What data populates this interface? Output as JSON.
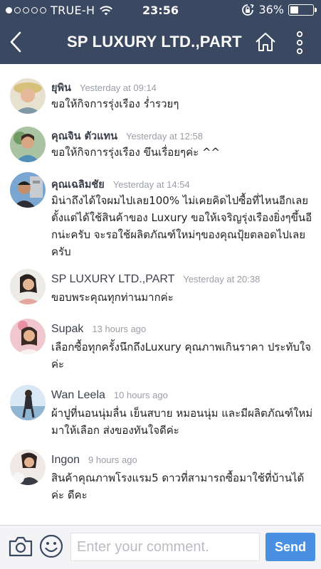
{
  "status_bar": {
    "carrier": "TRUE-H",
    "time": "23:56",
    "battery": "36%",
    "battery_level": 0.36,
    "signal_dots_filled": 1,
    "signal_dots_total": 5
  },
  "nav": {
    "title": "SP LUXURY LTD.,PART",
    "icons": [
      "chevron-left-icon",
      "home-icon",
      "more-vertical-icon"
    ]
  },
  "comments": [
    {
      "name": "ยุพิน",
      "time": "Yesterday at 09:14",
      "text": "ขอให้กิจการรุ่งเรือง ร่ำรวยๆ"
    },
    {
      "name": "คุณจิน ตัวแทน",
      "time": "Yesterday at 12:58",
      "text": "ขอให้กิจการรุ่งเรือง ขึนเรื่อยๆค่ะ ^^"
    },
    {
      "name": "คุณเฉลิมชัย",
      "time": "Yesterday at 14:54",
      "text": "มิน่าถึงได้ใจผมไปเลย100% ไม่เคยคิดไปซื้อที่ไหนอีกเลย ตั้งแต่ได้ใช้สินค้าของ Luxury ขอให้เจริญรุ่งเรืองยิ่งๆขึ้นอีกน่ะครับ จะรอใช้ผลิตภัณฑ์ใหม่ๆของคุณปุ้ยตลอดไปเลยครับ"
    },
    {
      "name": "SP LUXURY LTD.,PART",
      "time": "Yesterday at 20:38",
      "text": "ขอบพระคุณทุกท่านมากค่ะ"
    },
    {
      "name": "Supak",
      "time": "13 hours ago",
      "text": "เลือกซื้อทุกครั้งนึกถึงLuxury คุณภาพเกินราคา ประทับใจค่ะ"
    },
    {
      "name": "Wan Leela",
      "time": "10 hours ago",
      "text": "ผ้าปูที่นอนนุ่มลื่น เย็นสบาย หมอนนุ่ม และมีผลิตภัณฑ์ใหม่มาให้เลือก  ส่งของทันใจดีค่ะ"
    },
    {
      "name": "Ingon",
      "time": "9 hours ago",
      "text": "สินค้าคุณภาพโรงแรม5 ดาวที่สามารถซื้อมาใช้ที่บ้านได้ค่ะ ดีคะ"
    }
  ],
  "composer": {
    "placeholder": "Enter your comment.",
    "send_label": "Send",
    "icons": [
      "camera-icon",
      "smiley-icon"
    ]
  },
  "colors": {
    "nav_bg": "#3b4861",
    "send_bg": "#4a90e2",
    "timestamp": "#9a9ea6"
  }
}
